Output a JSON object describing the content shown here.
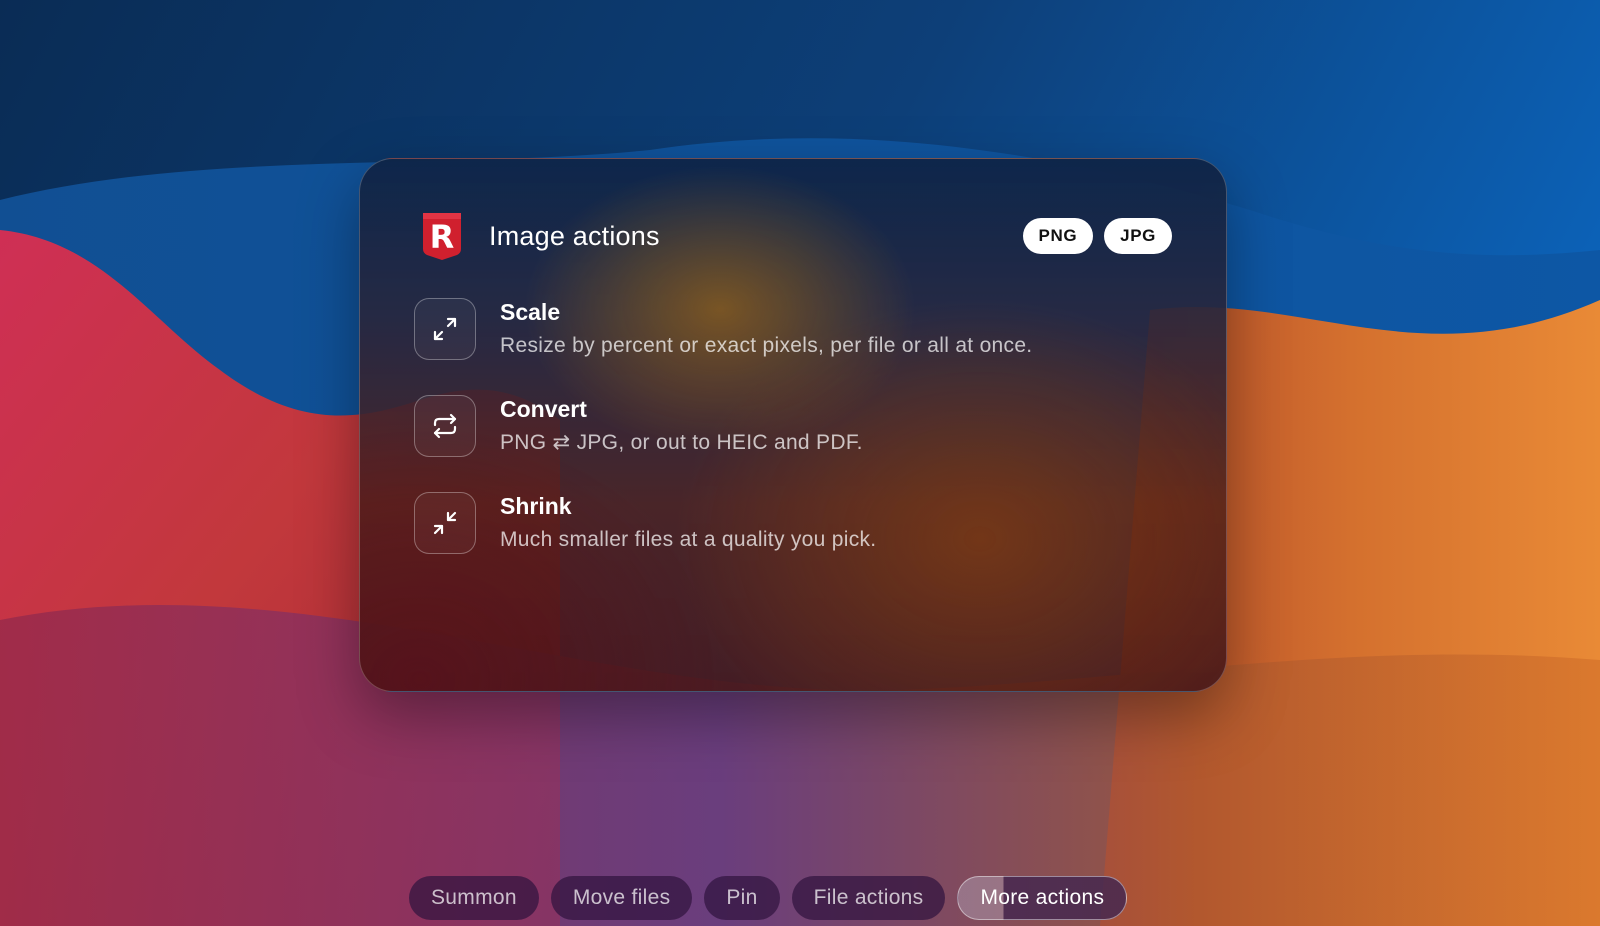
{
  "panel": {
    "title": "Image actions",
    "app_logo_letter": "R",
    "formats": [
      "PNG",
      "JPG"
    ]
  },
  "actions": [
    {
      "icon": "expand-arrows-icon",
      "title": "Scale",
      "description": "Resize by percent or exact pixels, per file or all at once."
    },
    {
      "icon": "swap-arrows-icon",
      "title": "Convert",
      "description": "PNG ⇄ JPG, or out to HEIC and PDF."
    },
    {
      "icon": "shrink-arrows-icon",
      "title": "Shrink",
      "description": "Much smaller files at a quality you pick."
    }
  ],
  "bottom_nav": {
    "tabs": [
      "Summon",
      "Move files",
      "Pin",
      "File actions",
      "More actions"
    ],
    "active": "More actions"
  },
  "colors": {
    "logo_red": "#d0202e",
    "pill_bg": "#ffffff",
    "wallpaper_blue": "#0d5aa8",
    "wallpaper_red": "#c42f45",
    "wallpaper_orange": "#e88934"
  }
}
